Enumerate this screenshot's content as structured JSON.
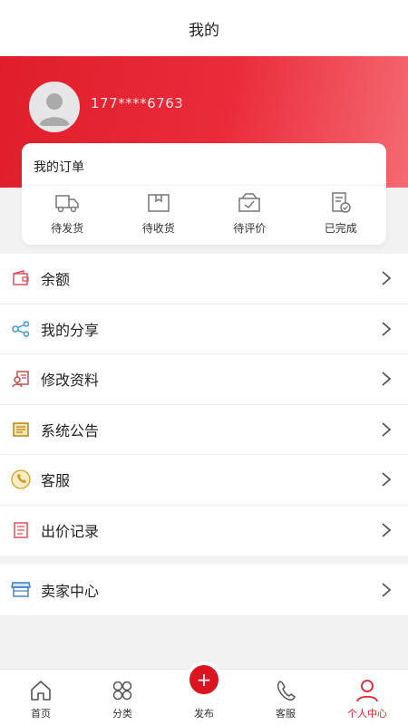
{
  "header": {
    "title": "我的"
  },
  "profile": {
    "phone": "177****6763"
  },
  "orders": {
    "title": "我的订单",
    "items": [
      {
        "label": "待发货",
        "icon": "truck-icon"
      },
      {
        "label": "待收货",
        "icon": "package-icon"
      },
      {
        "label": "待评价",
        "icon": "review-icon"
      },
      {
        "label": "已完成",
        "icon": "completed-icon"
      }
    ]
  },
  "menu": {
    "items": [
      {
        "label": "余额",
        "icon": "wallet-icon",
        "color": "#e0505a"
      },
      {
        "label": "我的分享",
        "icon": "share-icon",
        "color": "#3a9ad9"
      },
      {
        "label": "修改资料",
        "icon": "edit-profile-icon",
        "color": "#c0504d"
      },
      {
        "label": "系统公告",
        "icon": "notice-icon",
        "color": "#b8860b"
      },
      {
        "label": "客服",
        "icon": "phone-icon",
        "color": "#d4a017"
      },
      {
        "label": "出价记录",
        "icon": "list-icon",
        "color": "#e0505a"
      }
    ],
    "seller": {
      "label": "卖家中心",
      "icon": "store-icon",
      "color": "#3a7fc1"
    }
  },
  "tabbar": {
    "items": [
      {
        "label": "首页",
        "icon": "home-icon"
      },
      {
        "label": "分类",
        "icon": "category-icon"
      },
      {
        "label": "发布",
        "icon": "publish-icon"
      },
      {
        "label": "客服",
        "icon": "service-icon"
      },
      {
        "label": "个人中心",
        "icon": "user-icon"
      }
    ],
    "publish_symbol": "+",
    "active_color": "#e0202c"
  },
  "colors": {
    "brand_red": "#e01e2b"
  }
}
